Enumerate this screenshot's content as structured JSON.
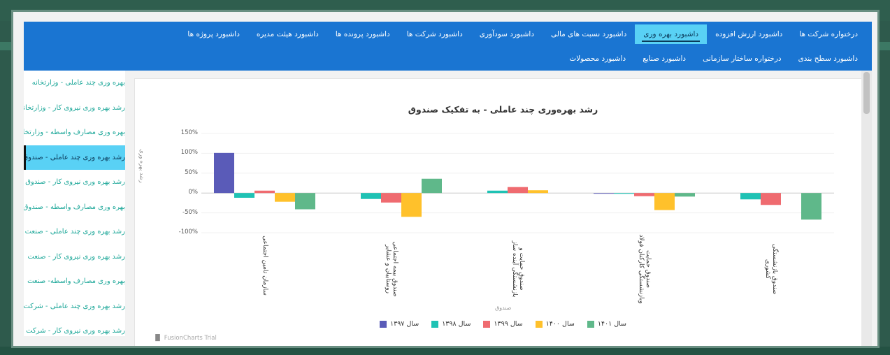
{
  "nav": {
    "row1": [
      {
        "label": "درختواره شرکت ها",
        "active": false
      },
      {
        "label": "داشبورد ارزش افزوده",
        "active": false
      },
      {
        "label": "داشبورد بهره وری",
        "active": true
      },
      {
        "label": "داشبورد نسبت های مالی",
        "active": false
      },
      {
        "label": "داشبورد سودآوری",
        "active": false
      },
      {
        "label": "داشبورد شرکت ها",
        "active": false
      },
      {
        "label": "داشبورد پرونده ها",
        "active": false
      },
      {
        "label": "داشبورد هیئت مدیره",
        "active": false
      },
      {
        "label": "داشبورد پروژه ها",
        "active": false
      }
    ],
    "row2": [
      {
        "label": "داشبورد سطح بندی",
        "active": false
      },
      {
        "label": "درختواره ساختار سازمانی",
        "active": false
      },
      {
        "label": "داشبورد صنایع",
        "active": false
      },
      {
        "label": "داشبورد محصولات",
        "active": false
      }
    ]
  },
  "sidebar": {
    "items": [
      {
        "label": "بهره وری چند عاملی - وزارتخانه",
        "active": false
      },
      {
        "label": "رشد بهره وری نیروی کار - وزارتخانه",
        "active": false
      },
      {
        "label": "بهره وری مصارف واسطه - وزارتخانه",
        "active": false
      },
      {
        "label": "رشد بهره وری چند عاملی - صندوق",
        "active": true
      },
      {
        "label": "رشد بهره وری نیروی کار - صندوق",
        "active": false
      },
      {
        "label": "بهره وری مصارف واسطه - صندوق",
        "active": false
      },
      {
        "label": "رشد بهره وری چند عاملی - صنعت",
        "active": false
      },
      {
        "label": "رشد بهره وری نیروی کار - صنعت",
        "active": false
      },
      {
        "label": "بهره وری مصارف واسطه- صنعت",
        "active": false
      },
      {
        "label": "رشد بهره وری چند عاملی - شرکت",
        "active": false
      },
      {
        "label": "رشد بهره وری نیروی کار - شرکت",
        "active": false
      }
    ]
  },
  "fusion_label": "FusionCharts Trial",
  "chart_data": {
    "type": "bar",
    "title": "رشد بهره‌وری چند عاملی - به تفکیک صندوق",
    "xlabel": "صندوق",
    "ylabel": "رشد بهره وری",
    "ylim": [
      -100,
      150
    ],
    "yticks": [
      "150%",
      "100%",
      "50%",
      "0%",
      "-50%",
      "-100%"
    ],
    "categories": [
      "سازمان تامین اجتماعی",
      "صندوق بیمه اجتماعی\nروستاییان و عشایر",
      "صندوق حمایت و\nبازنشستگی آینده ساز",
      "صندوق حمایت\nوبازنشستگی کارکنان فولاد",
      "صندوق بازنشستگی کشوری"
    ],
    "series": [
      {
        "name": "سال ۱۳۹۷",
        "color": "#5a5bb8",
        "values": [
          101,
          0,
          0,
          -1,
          0
        ]
      },
      {
        "name": "سال ۱۳۹۸",
        "color": "#1fc2b4",
        "values": [
          -12,
          -15,
          6,
          -2,
          -16
        ]
      },
      {
        "name": "سال ۱۳۹۹",
        "color": "#ef6b70",
        "values": [
          6,
          -24,
          15,
          -8,
          -30
        ]
      },
      {
        "name": "سال ۱۴۰۰",
        "color": "#ffc12b",
        "values": [
          -22,
          -60,
          7,
          -43,
          0
        ]
      },
      {
        "name": "سال ۱۴۰۱",
        "color": "#5fb88a",
        "values": [
          -41,
          36,
          0,
          -9,
          -67
        ]
      }
    ]
  }
}
